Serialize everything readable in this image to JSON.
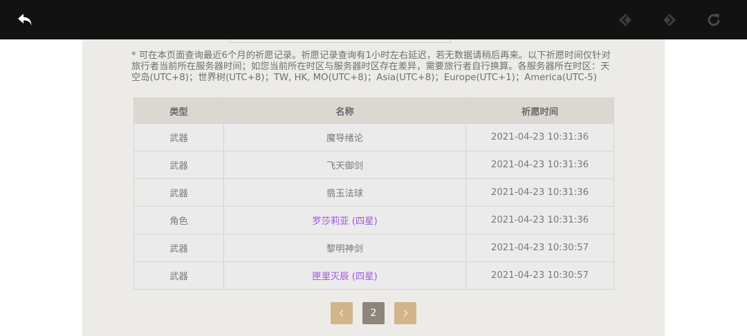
{
  "notice": "* 可在本页面查询最近6个月的祈愿记录。祈愿记录查询有1小时左右延迟，若无数据请稍后再来。以下祈愿时间仅针对旅行者当前所在服务器时间；如您当前所在时区与服务器时区存在差异，需要旅行者自行换算。各服务器所在时区：天空岛(UTC+8)；世界树(UTC+8)；TW, HK, MO(UTC+8)；Asia(UTC+8)；Europe(UTC+1)；America(UTC-5)",
  "table": {
    "headers": [
      "类型",
      "名称",
      "祈愿时间"
    ],
    "rows": [
      {
        "type": "武器",
        "name": "魔导绪论",
        "time": "2021-04-23 10:31:36",
        "four_star": false
      },
      {
        "type": "武器",
        "name": "飞天御剑",
        "time": "2021-04-23 10:31:36",
        "four_star": false
      },
      {
        "type": "武器",
        "name": "翡玉法球",
        "time": "2021-04-23 10:31:36",
        "four_star": false
      },
      {
        "type": "角色",
        "name": "罗莎莉亚 (四星)",
        "time": "2021-04-23 10:31:36",
        "four_star": true
      },
      {
        "type": "武器",
        "name": "黎明神剑",
        "time": "2021-04-23 10:30:57",
        "four_star": false
      },
      {
        "type": "武器",
        "name": "匣里灭辰 (四星)",
        "time": "2021-04-23 10:30:57",
        "four_star": true
      }
    ]
  },
  "pagination": {
    "current_page": "2",
    "prev_icon": "chevron-left-icon",
    "next_icon": "chevron-right-icon"
  },
  "toolbar": {
    "icons": [
      "undo-arrow-icon",
      "back-diamond-icon",
      "forward-diamond-icon",
      "refresh-icon"
    ]
  },
  "colors": {
    "topbar": "#121212",
    "panel": "#ecebe8",
    "header_row": "#dbd8d2",
    "four_star_text": "#a256e1",
    "pager_nav": "#d3b58a",
    "pager_current": "#8e857c"
  }
}
